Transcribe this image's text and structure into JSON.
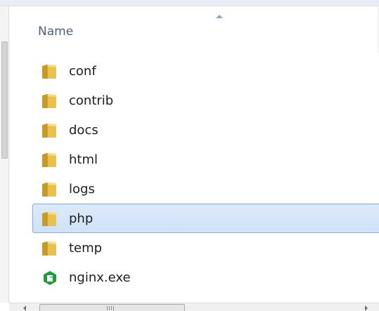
{
  "header": {
    "name_column": "Name"
  },
  "files": [
    {
      "name": "conf",
      "type": "folder",
      "selected": false
    },
    {
      "name": "contrib",
      "type": "folder",
      "selected": false
    },
    {
      "name": "docs",
      "type": "folder",
      "selected": false
    },
    {
      "name": "html",
      "type": "folder",
      "selected": false
    },
    {
      "name": "logs",
      "type": "folder",
      "selected": false
    },
    {
      "name": "php",
      "type": "folder",
      "selected": true
    },
    {
      "name": "temp",
      "type": "folder",
      "selected": false
    },
    {
      "name": "nginx.exe",
      "type": "exe",
      "selected": false
    }
  ],
  "icons": {
    "folder": "folder-icon",
    "exe": "nginx-app-icon"
  },
  "colors": {
    "selection_bg": "#cfe2f7",
    "selection_border": "#84acdd",
    "folder_yellow": "#e8c250",
    "nginx_green": "#1f9d3a",
    "header_text": "#4c607a"
  }
}
